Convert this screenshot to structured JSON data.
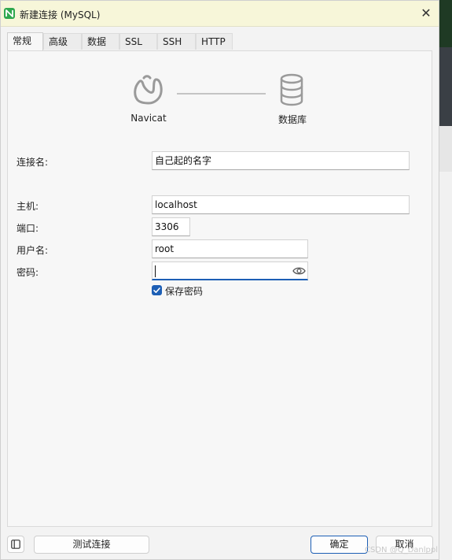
{
  "window": {
    "title": "新建连接 (MySQL)",
    "close_glyph": "✕"
  },
  "tabs": [
    {
      "label": "常规",
      "active": true
    },
    {
      "label": "高级",
      "active": false
    },
    {
      "label": "数据库",
      "active": false
    },
    {
      "label": "SSL",
      "active": false
    },
    {
      "label": "SSH",
      "active": false
    },
    {
      "label": "HTTP",
      "active": false
    }
  ],
  "diagram": {
    "left_label": "Navicat",
    "right_label": "数据库",
    "left_icon": "navicat-logo-icon",
    "right_icon": "database-icon"
  },
  "form": {
    "connection_name": {
      "label": "连接名:",
      "value": "自己起的名字"
    },
    "host": {
      "label": "主机:",
      "value": "localhost"
    },
    "port": {
      "label": "端口:",
      "value": "3306"
    },
    "username": {
      "label": "用户名:",
      "value": "root"
    },
    "password": {
      "label": "密码:",
      "value": ""
    },
    "save_password": {
      "label": "保存密码",
      "checked": true
    }
  },
  "footer": {
    "test_connection": "测试连接",
    "ok": "确定",
    "cancel": "取消"
  },
  "watermark": "CSDN @Q_Danlppl",
  "colors": {
    "accent": "#1d5fb5",
    "titlebar": "#f7f6d9",
    "app_icon": "#2fa84f"
  }
}
